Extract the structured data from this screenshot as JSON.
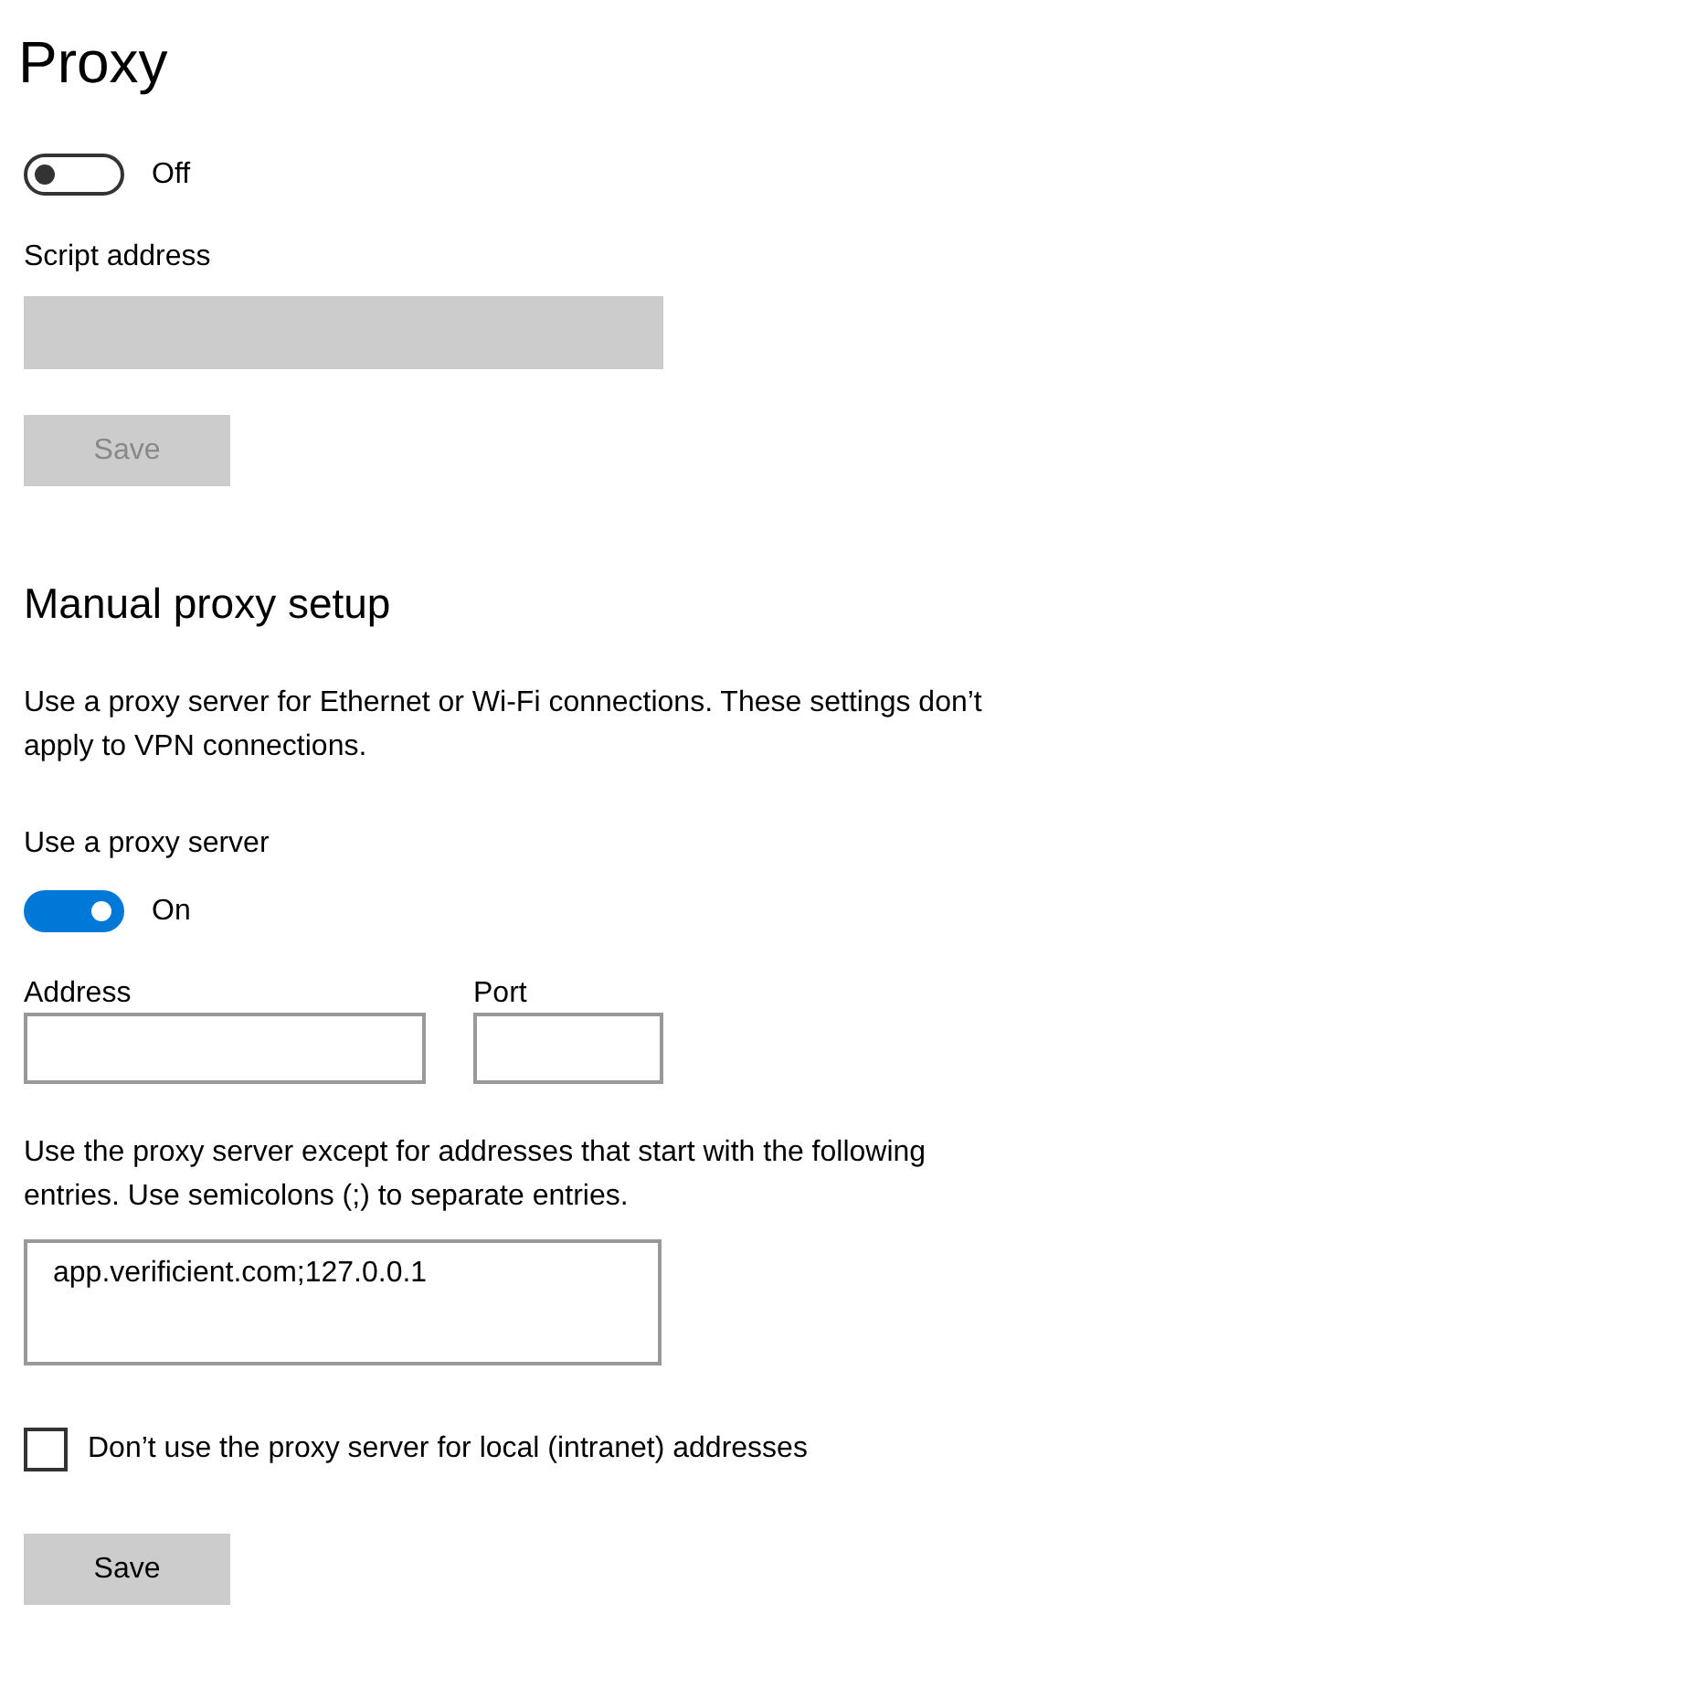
{
  "title": "Proxy",
  "auto_setup": {
    "toggle": {
      "on": false,
      "label": "Off"
    },
    "script_address": {
      "label": "Script address",
      "disabled": true
    },
    "save": {
      "label": "Save",
      "disabled": true
    }
  },
  "manual": {
    "heading": "Manual proxy setup",
    "description": "Use a proxy server for Ethernet or Wi-Fi connections. These settings don’t apply to VPN connections.",
    "use_proxy": {
      "label": "Use a proxy server",
      "on": true,
      "state_label": "On"
    },
    "address": {
      "label": "Address"
    },
    "port": {
      "label": "Port"
    },
    "exceptions": {
      "description": "Use the proxy server except for addresses that start with the following entries. Use semicolons (;) to separate entries.",
      "value": "app.verificient.com;127.0.0.1"
    },
    "local": {
      "label": "Don’t use the proxy server for local (intranet) addresses",
      "checked": false
    },
    "save": {
      "label": "Save",
      "disabled": false
    }
  }
}
